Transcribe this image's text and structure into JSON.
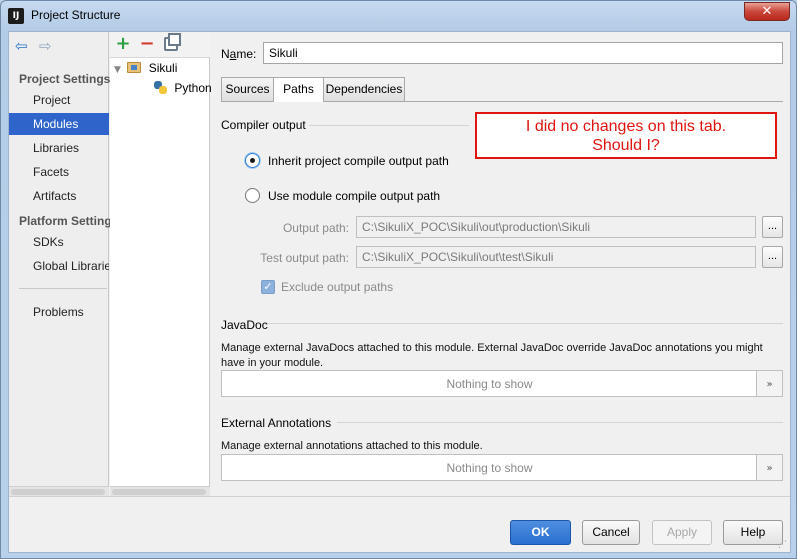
{
  "window": {
    "title": "Project Structure",
    "close_glyph": "✕"
  },
  "sidebar": {
    "back_icon": "back-arrow-icon",
    "forward_icon": "forward-arrow-icon",
    "sections": {
      "project_settings": "Project Settings",
      "platform_settings": "Platform Settings"
    },
    "items": {
      "project": "Project",
      "modules": "Modules",
      "libraries": "Libraries",
      "facets": "Facets",
      "artifacts": "Artifacts",
      "sdks": "SDKs",
      "global_libraries": "Global Libraries",
      "problems": "Problems"
    },
    "selected": "Modules"
  },
  "tree": {
    "toolbar": {
      "add_glyph": "+",
      "remove_glyph": "−"
    },
    "nodes": {
      "module": "Sikuli",
      "facet": "Python"
    }
  },
  "main": {
    "name_label_prefix": "N",
    "name_label_underlined": "a",
    "name_label_suffix": "me:",
    "name_value": "Sikuli",
    "tabs": {
      "sources": "Sources",
      "paths": "Paths",
      "dependencies": "Dependencies"
    },
    "active_tab": "Paths",
    "compiler_output": {
      "title": "Compiler output",
      "inherit_label": "Inherit project compile output path",
      "use_module_label": "Use module compile output path",
      "selected": "inherit",
      "output_path_label": "Output path:",
      "output_path_value": "C:\\SikuliX_POC\\Sikuli\\out\\production\\Sikuli",
      "test_output_path_label": "Test output path:",
      "test_output_path_value": "C:\\SikuliX_POC\\Sikuli\\out\\test\\Sikuli",
      "browse_label": "...",
      "exclude_label": "Exclude output paths",
      "exclude_checked": true,
      "check_glyph": "✓"
    },
    "javadoc": {
      "title": "JavaDoc",
      "description": "Manage external JavaDocs attached to this module. External JavaDoc override JavaDoc annotations you might have in your module.",
      "empty_text": "Nothing to show",
      "more_glyph": "»"
    },
    "external_annotations": {
      "title": "External Annotations",
      "description": "Manage external annotations attached to this module.",
      "empty_text": "Nothing to show",
      "more_glyph": "»"
    },
    "annotation_note": {
      "line1": "I did no changes on this tab.",
      "line2": "Should I?",
      "color": "#e0150f"
    }
  },
  "buttons": {
    "ok": "OK",
    "cancel": "Cancel",
    "apply": "Apply",
    "help": "Help"
  },
  "colors": {
    "selection": "#2f65ca",
    "primary_button": "#2a6fd0"
  }
}
